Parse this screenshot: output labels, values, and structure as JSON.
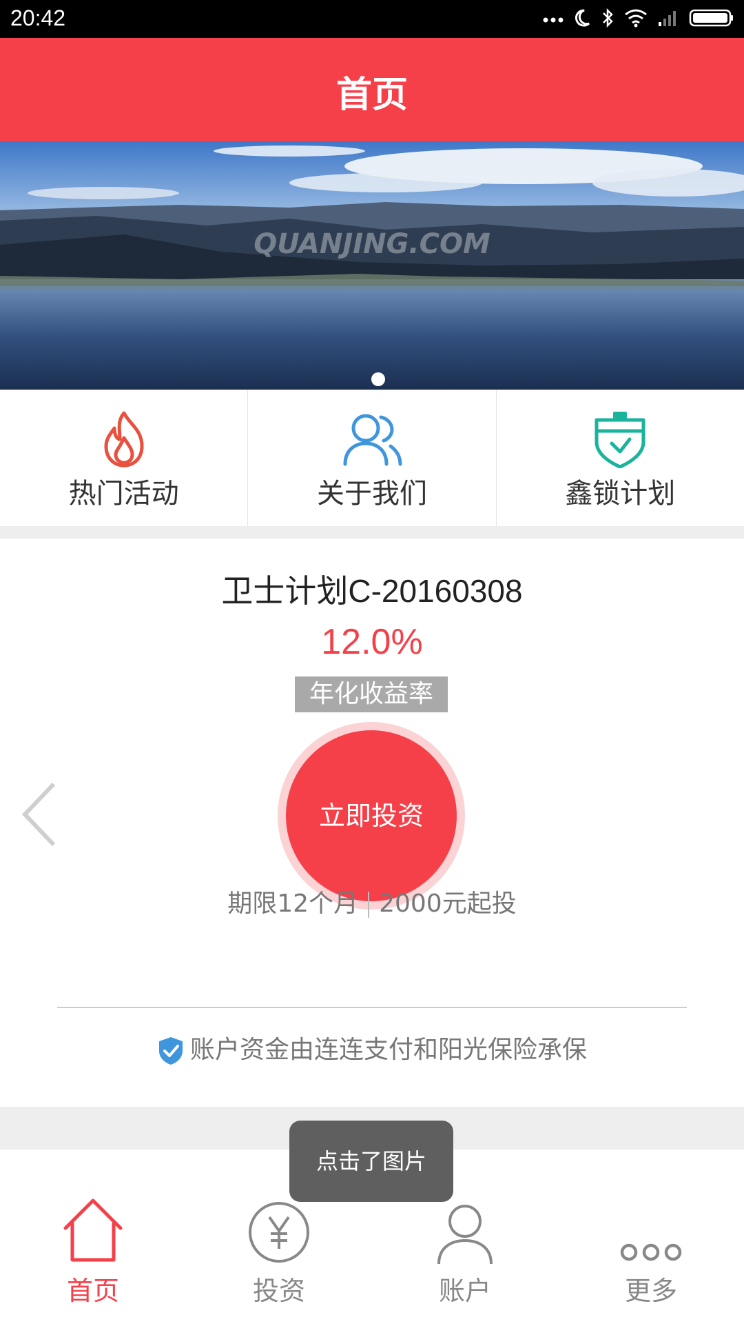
{
  "status_bar": {
    "time": "20:42"
  },
  "header": {
    "title": "首页"
  },
  "banner": {
    "watermark": "QUANJING.COM",
    "slide_count": 1,
    "active_slide": 1
  },
  "quick_links": [
    {
      "label": "热门活动",
      "icon": "flame-icon",
      "color": "#e8513f"
    },
    {
      "label": "关于我们",
      "icon": "users-icon",
      "color": "#3f96dd"
    },
    {
      "label": "鑫锁计划",
      "icon": "shield-badge-icon",
      "color": "#1ab39b"
    }
  ],
  "product": {
    "name": "卫士计划C-20160308",
    "rate": "12.0%",
    "rate_label": "年化收益率",
    "invest_button": "立即投资",
    "term": "期限12个月",
    "min_amount": "2000元起投",
    "guarantee": "账户资金由连连支付和阳光保险承保"
  },
  "toast": {
    "message": "点击了图片"
  },
  "tabs": [
    {
      "label": "首页",
      "icon": "home-icon",
      "active": true
    },
    {
      "label": "投资",
      "icon": "yen-coin-icon",
      "active": false
    },
    {
      "label": "账户",
      "icon": "user-icon",
      "active": false
    },
    {
      "label": "更多",
      "icon": "more-dots-icon",
      "active": false
    }
  ],
  "colors": {
    "brand": "#f54049",
    "brand_light": "#fbd3d5",
    "tag_gray": "#a9a9a9",
    "tab_inactive": "#888888"
  }
}
